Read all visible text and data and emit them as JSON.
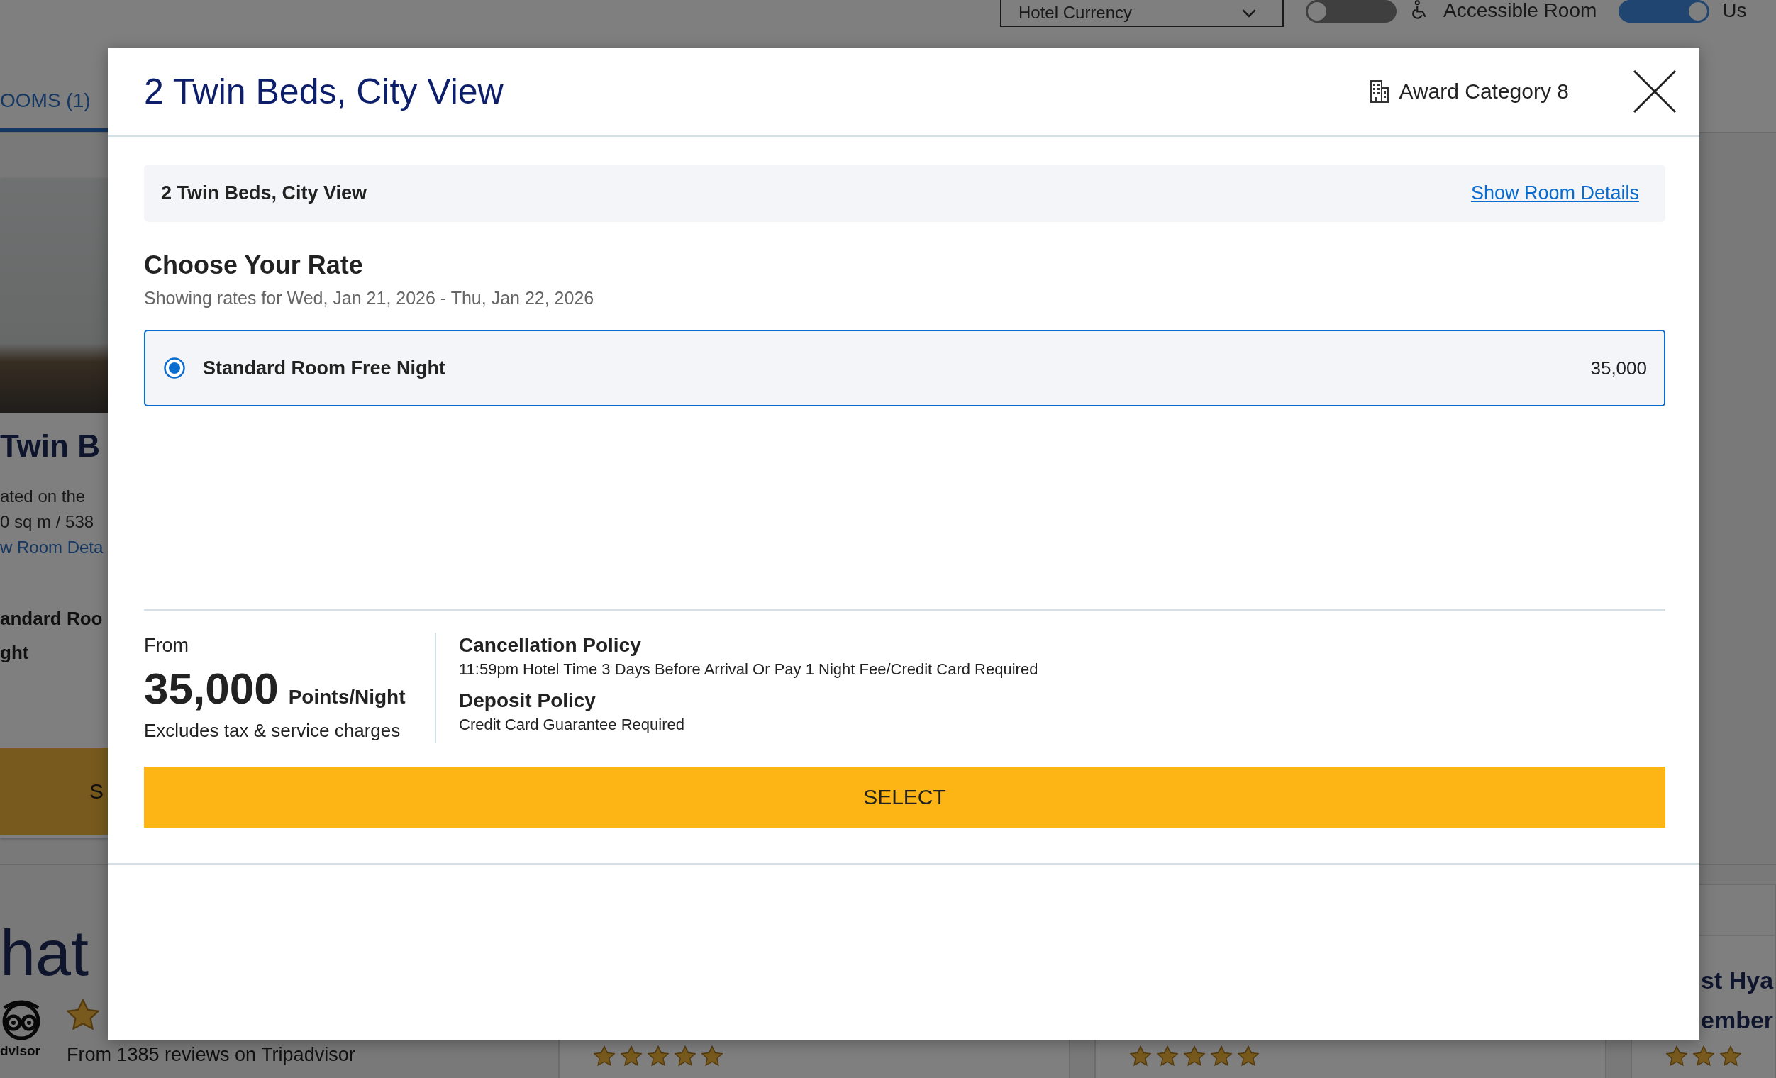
{
  "toolbar": {
    "currency_select": {
      "value": "Hotel Currency"
    },
    "toggles": [
      {
        "kind": "accessible",
        "label": "Accessible Room",
        "on": false
      },
      {
        "kind": "plain",
        "label": "Us",
        "on": true
      }
    ]
  },
  "tabs": [
    {
      "label": "OOMS (1)",
      "selected": true
    }
  ],
  "room_card": {
    "title": "Twin B",
    "details": [
      "ated on the",
      "0 sq m / 538"
    ],
    "details_link": "w Room Deta",
    "rate_lines": [
      "andard Roo",
      "ght"
    ],
    "button": "S"
  },
  "reviews": {
    "heading": "hat",
    "logo_text": "dvisor",
    "summary": "From 1385 reviews on Tripadvisor",
    "cards": [
      {
        "stars": 5
      },
      {
        "stars": 5
      },
      {
        "title_lines": [
          "st Hya",
          "ember"
        ],
        "stars": 3
      }
    ]
  },
  "modal": {
    "title": "2 Twin Beds, City View",
    "award_category": "Award Category 8",
    "room_name": "2 Twin Beds, City View",
    "details_link": "Show Room Details",
    "section_title": "Choose Your Rate",
    "date_range": "Showing rates for Wed, Jan 21, 2026 - Thu, Jan 22, 2026",
    "rates": [
      {
        "name": "Standard Room Free Night",
        "points": "35,000",
        "selected": true
      }
    ],
    "summary": {
      "from_label": "From",
      "points": "35,000",
      "unit": "Points/Night",
      "note": "Excludes tax & service charges",
      "policies": [
        {
          "title": "Cancellation Policy",
          "text": "11:59pm Hotel Time 3 Days Before Arrival Or Pay 1 Night Fee/Credit Card Required"
        },
        {
          "title": "Deposit Policy",
          "text": "Credit Card Guarantee Required"
        }
      ]
    },
    "select_button": "SELECT"
  }
}
